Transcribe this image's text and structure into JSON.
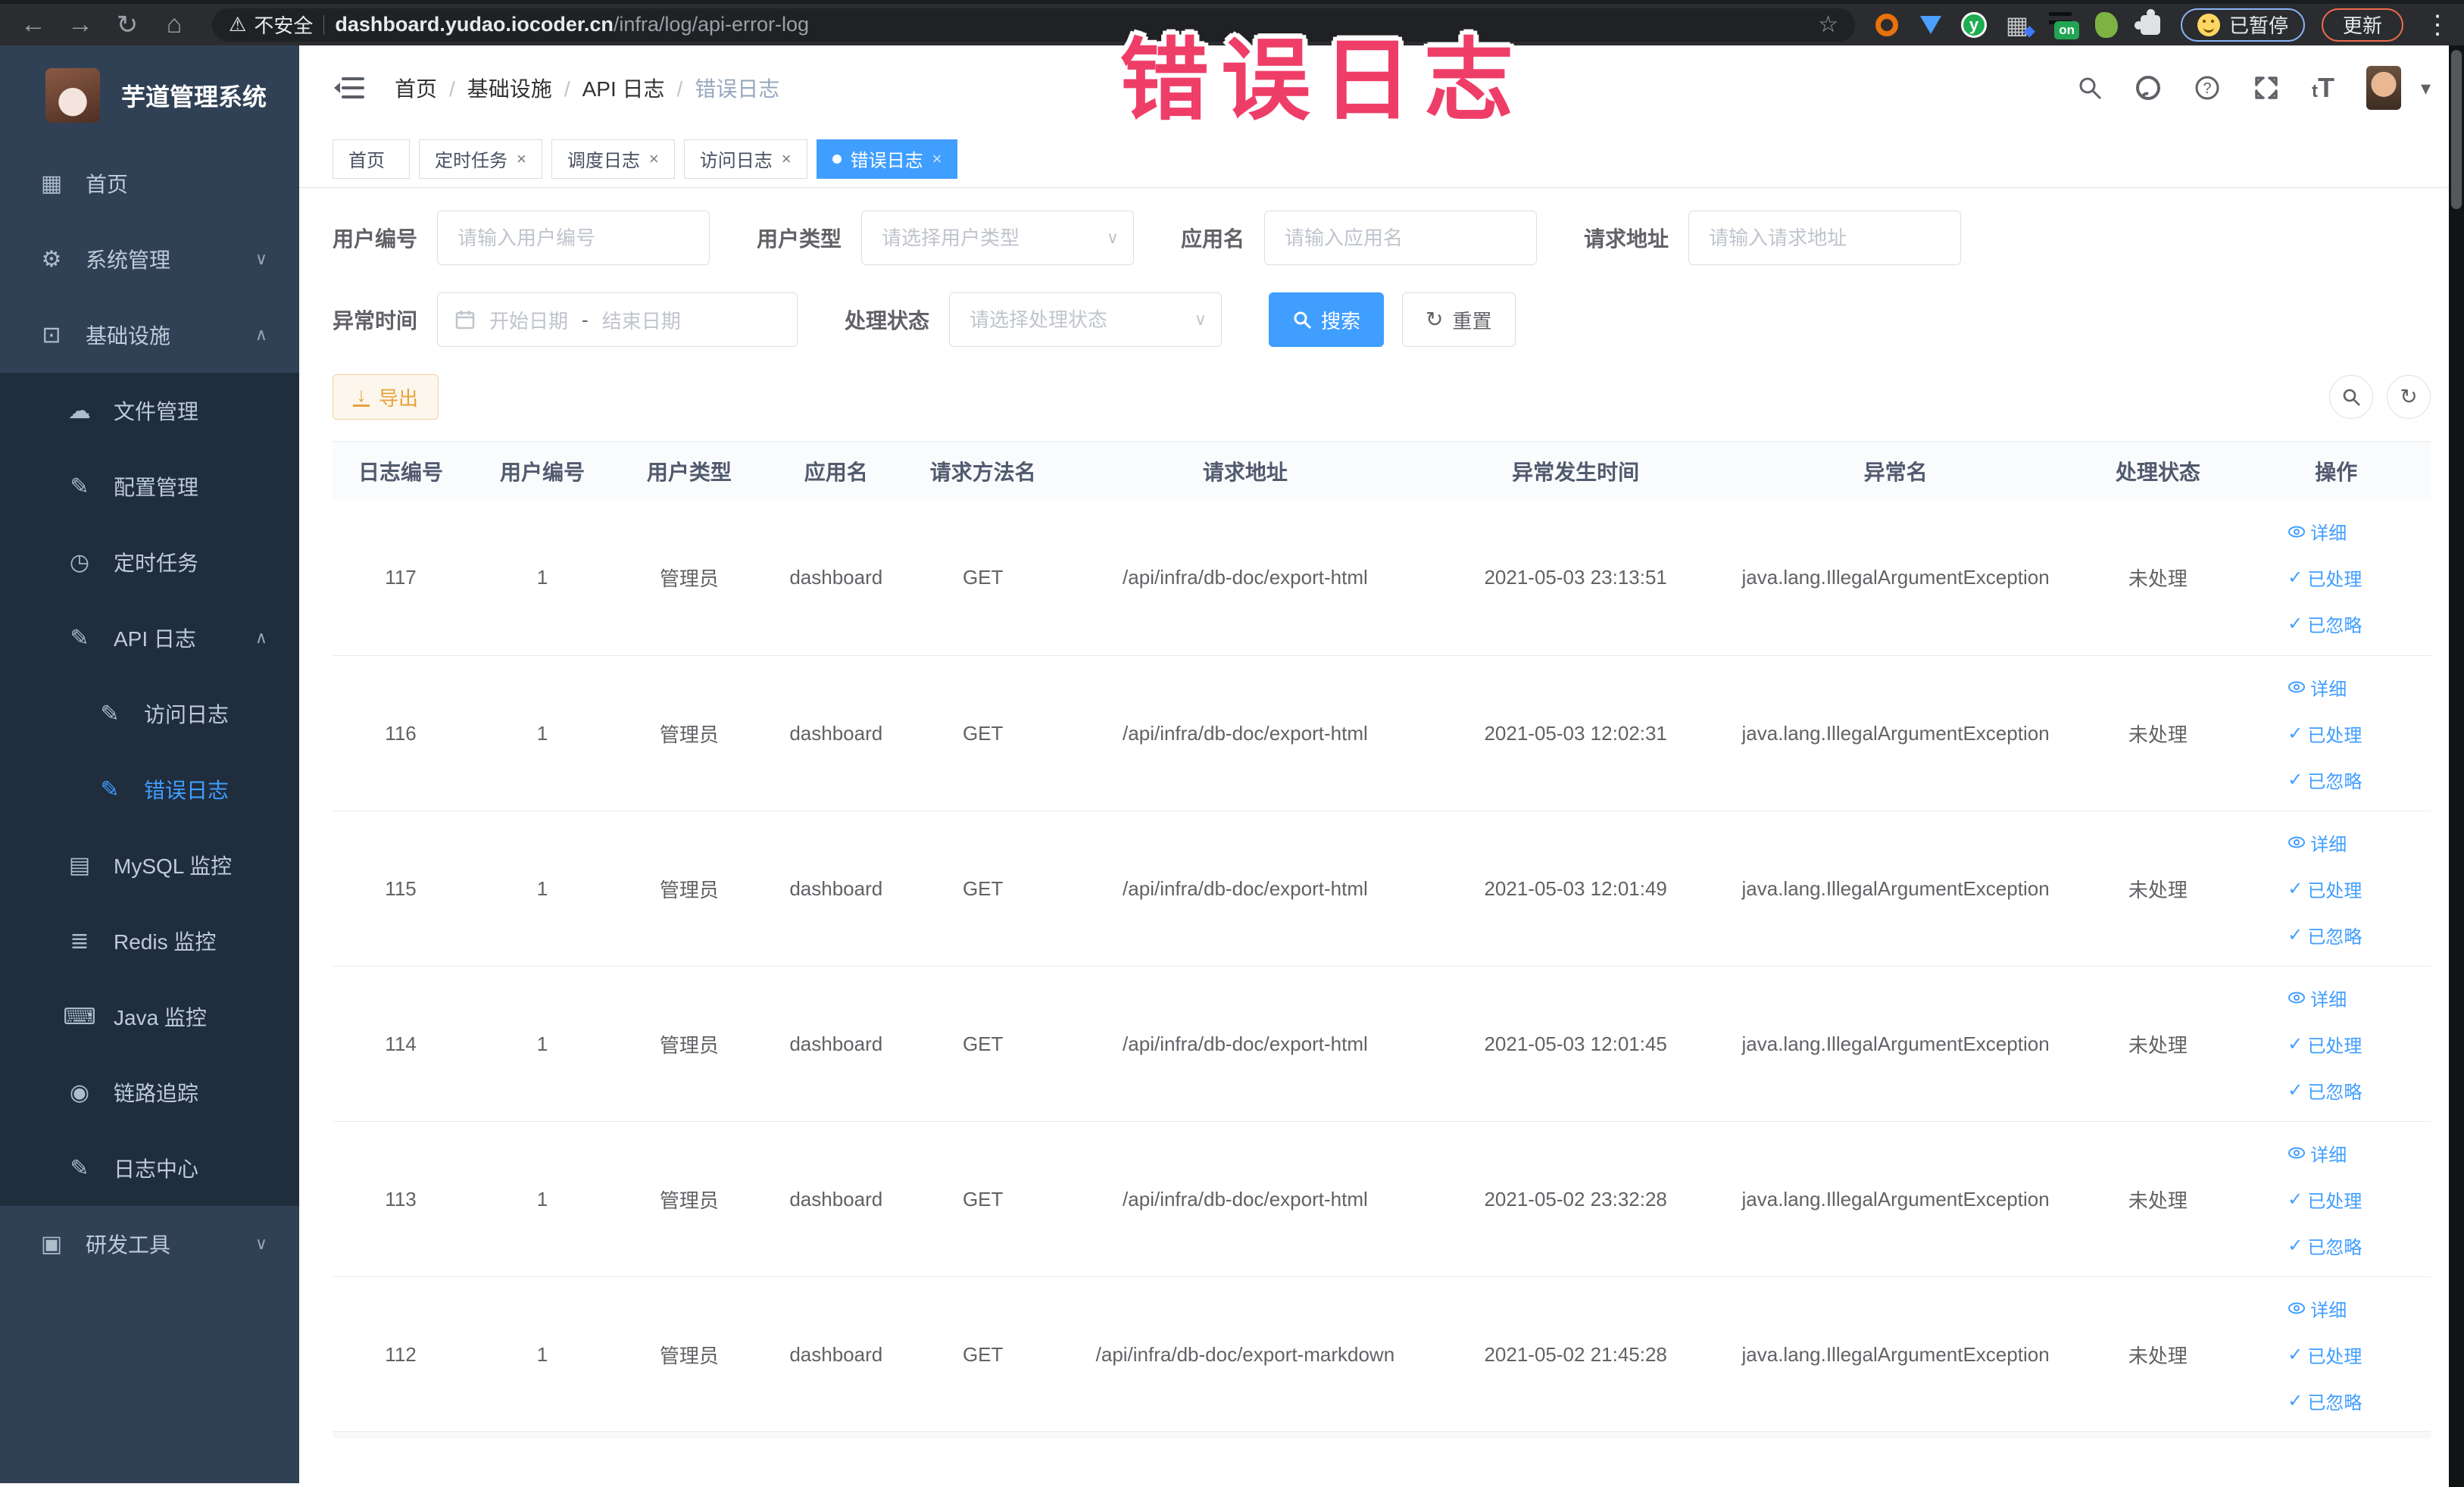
{
  "browser": {
    "back": "←",
    "forward": "→",
    "reload": "↻",
    "home": "⌂",
    "warn_glyph": "⚠",
    "security_chip": "不安全",
    "url_host": "dashboard.yudao.iocoder.cn",
    "url_path": "/infra/log/api-error-log",
    "bookmark_star": "☆",
    "ext_y_letter": "y",
    "ext_grid_glyph": "▦",
    "ext_grid_diamond": "◆",
    "ext_on_label": "on",
    "paused_label": "已暂停",
    "update_label": "更新",
    "menu_dots": "⋮"
  },
  "annotation": {
    "text": "错误日志"
  },
  "sidebar": {
    "title": "芋道管理系统",
    "items": [
      {
        "label": "首页",
        "icon": "▦",
        "arrow": "",
        "cls": "lvl1"
      },
      {
        "label": "系统管理",
        "icon": "⚙",
        "arrow": "∨",
        "cls": "lvl1"
      },
      {
        "label": "基础设施",
        "icon": "⊡",
        "arrow": "∧",
        "cls": "lvl1"
      },
      {
        "label": "文件管理",
        "icon": "☁",
        "arrow": "",
        "cls": "lvl2 sub"
      },
      {
        "label": "配置管理",
        "icon": "✎",
        "arrow": "",
        "cls": "lvl2 sub"
      },
      {
        "label": "定时任务",
        "icon": "◷",
        "arrow": "",
        "cls": "lvl2 sub"
      },
      {
        "label": "API 日志",
        "icon": "✎",
        "arrow": "∧",
        "cls": "lvl2 sub"
      },
      {
        "label": "访问日志",
        "icon": "✎",
        "arrow": "",
        "cls": "lvl3 sub"
      },
      {
        "label": "错误日志",
        "icon": "✎",
        "arrow": "",
        "cls": "lvl3 sub active"
      },
      {
        "label": "MySQL 监控",
        "icon": "▤",
        "arrow": "",
        "cls": "lvl2 sub"
      },
      {
        "label": "Redis 监控",
        "icon": "≣",
        "arrow": "",
        "cls": "lvl2 sub"
      },
      {
        "label": "Java 监控",
        "icon": "⌨",
        "arrow": "",
        "cls": "lvl2 sub"
      },
      {
        "label": "链路追踪",
        "icon": "◉",
        "arrow": "",
        "cls": "lvl2 sub"
      },
      {
        "label": "日志中心",
        "icon": "✎",
        "arrow": "",
        "cls": "lvl2 sub"
      },
      {
        "label": "研发工具",
        "icon": "▣",
        "arrow": "∨",
        "cls": "lvl1"
      }
    ]
  },
  "header": {
    "breadcrumb": [
      {
        "label": "首页",
        "cls": ""
      },
      {
        "label": "基础设施",
        "cls": ""
      },
      {
        "label": "API 日志",
        "cls": ""
      },
      {
        "label": "错误日志",
        "cls": "last"
      }
    ],
    "text_size_small": "t",
    "text_size_big": "T",
    "caret": "▾"
  },
  "tabs": [
    {
      "label": "首页",
      "cls": "",
      "close": ""
    },
    {
      "label": "定时任务",
      "cls": "",
      "close": "×"
    },
    {
      "label": "调度日志",
      "cls": "",
      "close": "×"
    },
    {
      "label": "访问日志",
      "cls": "",
      "close": "×"
    },
    {
      "label": "错误日志",
      "cls": "active",
      "close": "×"
    }
  ],
  "filters": {
    "fields": [
      {
        "label": "用户编号",
        "placeholder": "请输入用户编号",
        "chev": ""
      },
      {
        "label": "用户类型",
        "placeholder": "请选择用户类型",
        "chev": "∨"
      },
      {
        "label": "应用名",
        "placeholder": "请输入应用名",
        "chev": ""
      },
      {
        "label": "请求地址",
        "placeholder": "请输入请求地址",
        "chev": ""
      }
    ],
    "time_label": "异常时间",
    "date_start": "开始日期",
    "date_sep": "-",
    "date_end": "结束日期",
    "status_label": "处理状态",
    "status_placeholder": "请选择处理状态",
    "status_chev": "∨",
    "search_label": "搜索",
    "reset_label": "重置",
    "reset_glyph": "↻"
  },
  "toolbar": {
    "export_label": "导出",
    "refresh_glyph": "↻"
  },
  "table": {
    "columns": [
      {
        "label": "日志编号",
        "cls": "c0"
      },
      {
        "label": "用户编号",
        "cls": "c1"
      },
      {
        "label": "用户类型",
        "cls": "c2"
      },
      {
        "label": "应用名",
        "cls": "c3"
      },
      {
        "label": "请求方法名",
        "cls": "c4"
      },
      {
        "label": "请求地址",
        "cls": "c5"
      },
      {
        "label": "异常发生时间",
        "cls": "c6"
      },
      {
        "label": "异常名",
        "cls": "c7"
      },
      {
        "label": "处理状态",
        "cls": "c8"
      },
      {
        "label": "操作",
        "cls": "c9"
      }
    ],
    "actions": {
      "detail": "详细",
      "processed": "已处理",
      "ignored": "已忽略",
      "check": "✓"
    },
    "rows": [
      {
        "id": "117",
        "user_id": "1",
        "user_type": "管理员",
        "app": "dashboard",
        "method": "GET",
        "url": "/api/infra/db-doc/export-html",
        "time": "2021-05-03 23:13:51",
        "exception": "java.lang.IllegalArgumentException",
        "status": "未处理"
      },
      {
        "id": "116",
        "user_id": "1",
        "user_type": "管理员",
        "app": "dashboard",
        "method": "GET",
        "url": "/api/infra/db-doc/export-html",
        "time": "2021-05-03 12:02:31",
        "exception": "java.lang.IllegalArgumentException",
        "status": "未处理"
      },
      {
        "id": "115",
        "user_id": "1",
        "user_type": "管理员",
        "app": "dashboard",
        "method": "GET",
        "url": "/api/infra/db-doc/export-html",
        "time": "2021-05-03 12:01:49",
        "exception": "java.lang.IllegalArgumentException",
        "status": "未处理"
      },
      {
        "id": "114",
        "user_id": "1",
        "user_type": "管理员",
        "app": "dashboard",
        "method": "GET",
        "url": "/api/infra/db-doc/export-html",
        "time": "2021-05-03 12:01:45",
        "exception": "java.lang.IllegalArgumentException",
        "status": "未处理"
      },
      {
        "id": "113",
        "user_id": "1",
        "user_type": "管理员",
        "app": "dashboard",
        "method": "GET",
        "url": "/api/infra/db-doc/export-html",
        "time": "2021-05-02 23:32:28",
        "exception": "java.lang.IllegalArgumentException",
        "status": "未处理"
      },
      {
        "id": "112",
        "user_id": "1",
        "user_type": "管理员",
        "app": "dashboard",
        "method": "GET",
        "url": "/api/infra/db-doc/export-markdown",
        "time": "2021-05-02 21:45:28",
        "exception": "java.lang.IllegalArgumentException",
        "status": "未处理"
      }
    ]
  }
}
